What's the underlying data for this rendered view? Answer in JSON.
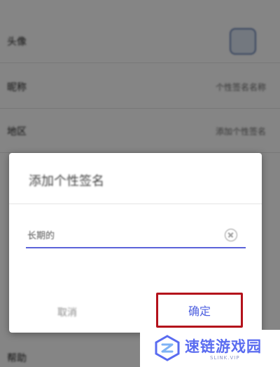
{
  "background_page": {
    "rows": [
      {
        "label": "头像",
        "value": ""
      },
      {
        "label": "昵称",
        "value": "个性签名名称"
      },
      {
        "label": "地区",
        "value": "添加个性签名"
      },
      {
        "label": "",
        "value": ""
      },
      {
        "label": "",
        "value": ""
      },
      {
        "label": "",
        "value": ""
      },
      {
        "label": "",
        "value": ""
      },
      {
        "label": "",
        "value": ""
      }
    ],
    "bottom_row_label": "帮助"
  },
  "dialog": {
    "title": "添加个性签名",
    "input_value": "长期的",
    "input_placeholder": "",
    "cancel_label": "取消",
    "confirm_label": "确定",
    "accent_color": "#5b63d9",
    "highlight_color": "#b4121b"
  },
  "watermark": {
    "name": "速链游戏园",
    "url": "SLINK.VIP"
  }
}
